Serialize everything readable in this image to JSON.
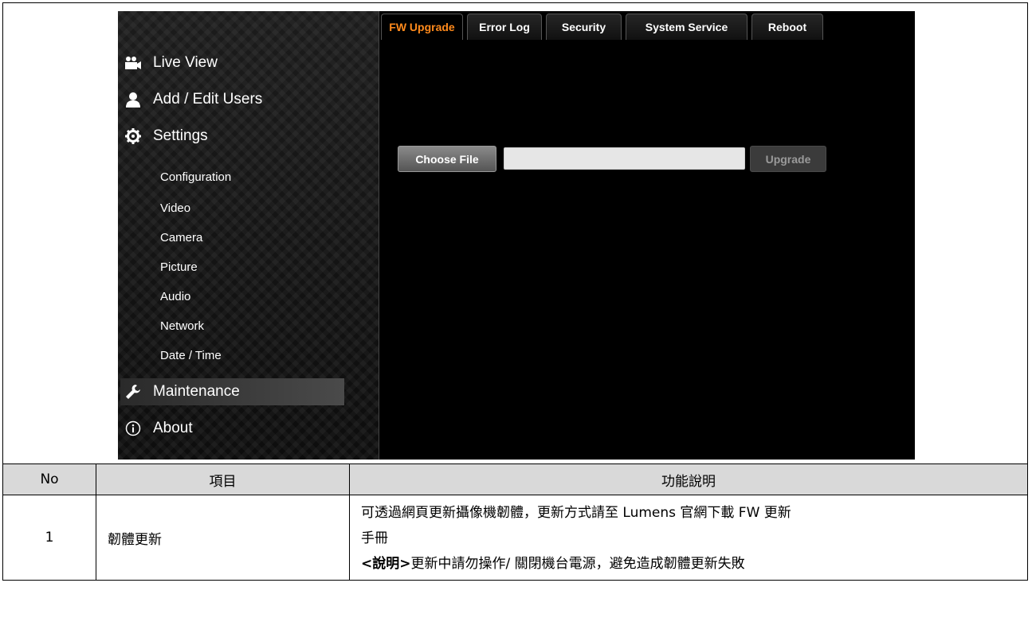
{
  "sidebar": {
    "main_items": [
      {
        "label": "Live View",
        "icon": "video-camera-icon"
      },
      {
        "label": "Add / Edit Users",
        "icon": "user-icon"
      },
      {
        "label": "Settings",
        "icon": "gear-icon"
      },
      {
        "label": "Maintenance",
        "icon": "wrench-icon",
        "active": true
      },
      {
        "label": "About",
        "icon": "info-icon"
      }
    ],
    "sub_items": [
      "Configuration",
      "Video",
      "Camera",
      "Picture",
      "Audio",
      "Network",
      "Date / Time"
    ]
  },
  "tabs": [
    {
      "label": "FW Upgrade",
      "active": true
    },
    {
      "label": "Error Log"
    },
    {
      "label": "Security"
    },
    {
      "label": "System Service"
    },
    {
      "label": "Reboot"
    }
  ],
  "fw": {
    "choose_label": "Choose File",
    "file_value": "",
    "upgrade_label": "Upgrade"
  },
  "table": {
    "headers": [
      "No",
      "項目",
      "功能說明"
    ],
    "rows": [
      {
        "no": "1",
        "item": "韌體更新",
        "desc_line1": "可透過網頁更新攝像機韌體，更新方式請至 Lumens 官網下載 FW 更新",
        "desc_line2": "手冊",
        "note_tag": "<說明>",
        "note_text": "更新中請勿操作/ 關閉機台電源，避免造成韌體更新失敗"
      }
    ]
  },
  "colors": {
    "accent_active_tab": "#ff8a1c",
    "header_bg": "#d9d9d9"
  }
}
